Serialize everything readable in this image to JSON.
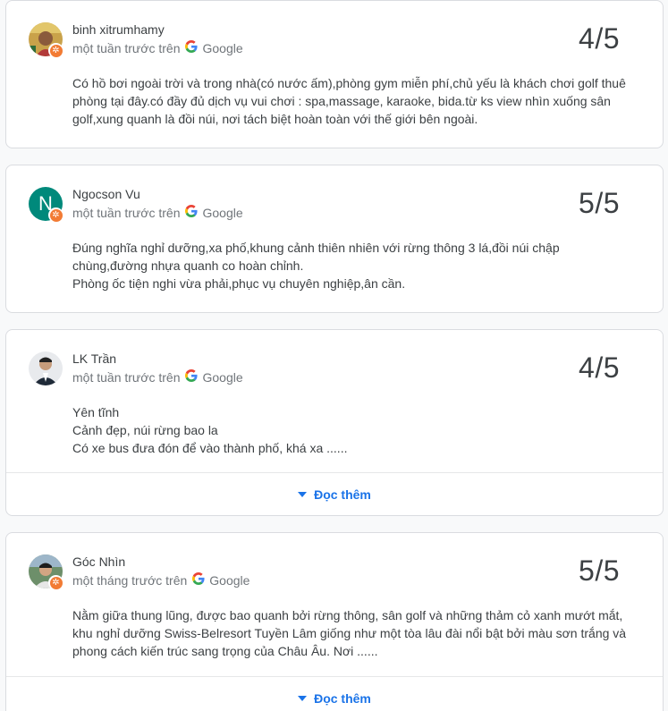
{
  "reviews": [
    {
      "author": "binh xitrumhamy",
      "time": "một tuần trước trên",
      "source": "Google",
      "rating": "4/5",
      "text": [
        "Có hồ bơi ngoài trời và trong nhà(có nước ấm),phòng gym miễn phí,chủ yếu là khách chơi golf thuê phòng tại đây.có đầy đủ dịch vụ vui chơi : spa,massage, karaoke, bida.từ ks view nhìn xuống sân golf,xung quanh là đồi núi, nơi tách biệt hoàn toàn với thế giới bên ngoài."
      ],
      "avatar_icon": "user-photo"
    },
    {
      "author": "Ngocson Vu",
      "time": "một tuần trước trên",
      "source": "Google",
      "rating": "5/5",
      "text": [
        "Đúng nghĩa nghỉ dưỡng,xa phố,khung cảnh thiên nhiên với rừng thông 3 lá,đồi núi chập chùng,đường nhựa quanh co hoàn chỉnh.",
        "Phòng ốc tiện nghi vừa phải,phục vụ chuyên nghiệp,ân cần."
      ],
      "avatar_letter": "N",
      "avatar_color": "#00897b"
    },
    {
      "author": "LK Trần",
      "time": "một tuần trước trên",
      "source": "Google",
      "rating": "4/5",
      "text": [
        "Yên tĩnh",
        "Cảnh đẹp, núi rừng bao la",
        "Có xe bus đưa đón để vào thành phố, khá xa ......"
      ],
      "read_more": "Đọc thêm",
      "avatar_icon": "user-photo"
    },
    {
      "author": "Góc Nhìn",
      "time": "một tháng trước trên",
      "source": "Google",
      "rating": "5/5",
      "text": [
        "Nằm giữa thung lũng, được bao quanh bởi rừng thông, sân golf và những thảm cỏ xanh mướt mắt, khu nghỉ dưỡng Swiss-Belresort Tuyền Lâm giống như một tòa lâu đài nổi bật bởi màu sơn trắng và phong cách kiến trúc sang trọng của Châu Âu. Nơi ......"
      ],
      "read_more": "Đọc thêm",
      "avatar_icon": "user-photo"
    }
  ],
  "colors": {
    "link": "#1a73e8",
    "badge": "#f27b34",
    "card_border": "#dadce0",
    "secondary_text": "#70757a"
  },
  "icons": {
    "google": "google-g-icon",
    "local_guide": "local-guide-badge-icon",
    "expand": "caret-down-icon"
  }
}
